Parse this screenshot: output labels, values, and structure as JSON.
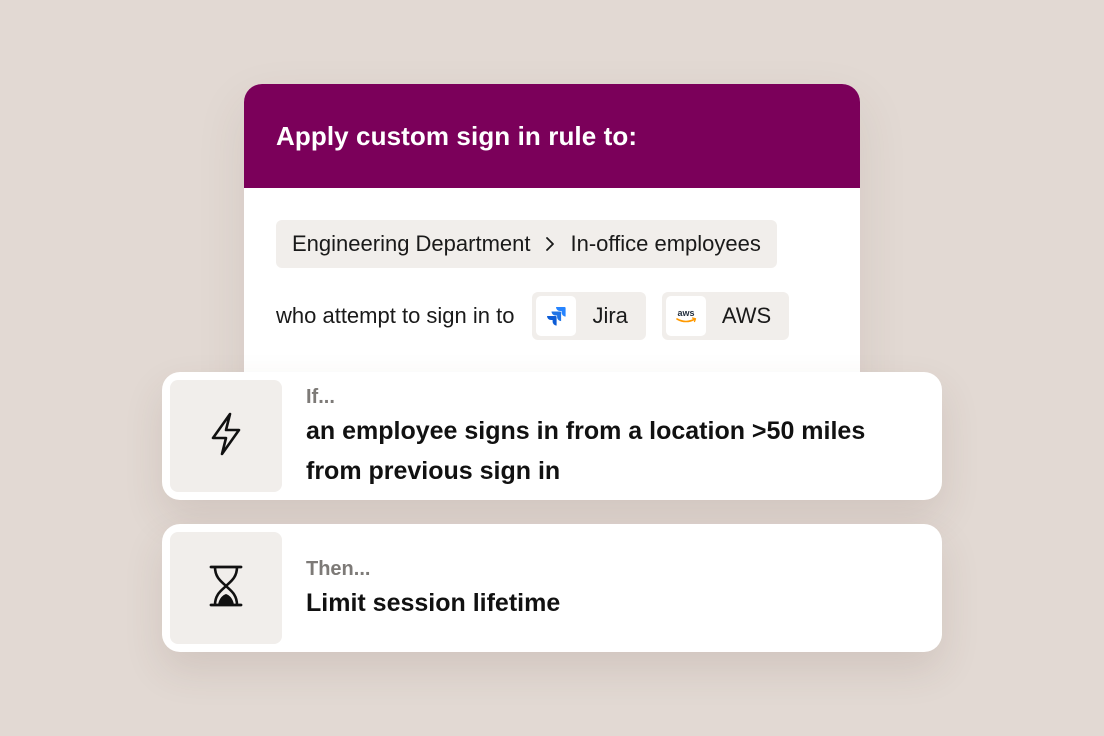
{
  "rule": {
    "title": "Apply custom sign in rule to:",
    "breadcrumb": {
      "parent": "Engineering Department",
      "child": "In-office employees"
    },
    "apps_lead": "who attempt to sign in to",
    "apps": [
      {
        "name": "Jira",
        "icon": "jira-logo-icon"
      },
      {
        "name": "AWS",
        "icon": "aws-logo-icon",
        "logo_text": "aws"
      }
    ]
  },
  "condition": {
    "label": "If...",
    "text": "an employee signs in from a location >50 miles from previous sign in",
    "icon": "lightning-bolt-icon"
  },
  "action": {
    "label": "Then...",
    "text": "Limit session lifetime",
    "icon": "hourglass-icon"
  },
  "colors": {
    "background": "#e2d9d3",
    "header": "#7b005a",
    "chip": "#f1eeeb",
    "muted_label": "#7d7a77",
    "jira_blue": "#2684ff",
    "aws_orange": "#ff9900"
  }
}
